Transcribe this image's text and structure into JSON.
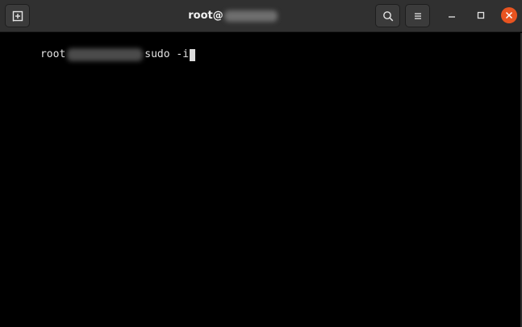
{
  "window": {
    "title_user": "root@",
    "title_host_redacted": ""
  },
  "titlebar": {
    "new_tab_icon": "new-tab-icon",
    "search_icon": "search-icon",
    "menu_icon": "menu-icon",
    "minimize_icon": "minimize-icon",
    "maximize_icon": "maximize-icon",
    "close_icon": "close-icon"
  },
  "terminal": {
    "prompt_user": "root",
    "prompt_host_redacted": "",
    "command": "sudo -i"
  },
  "colors": {
    "titlebar_bg": "#303030",
    "terminal_bg": "#000000",
    "close_button": "#e95420",
    "text": "#e4e4e4"
  }
}
